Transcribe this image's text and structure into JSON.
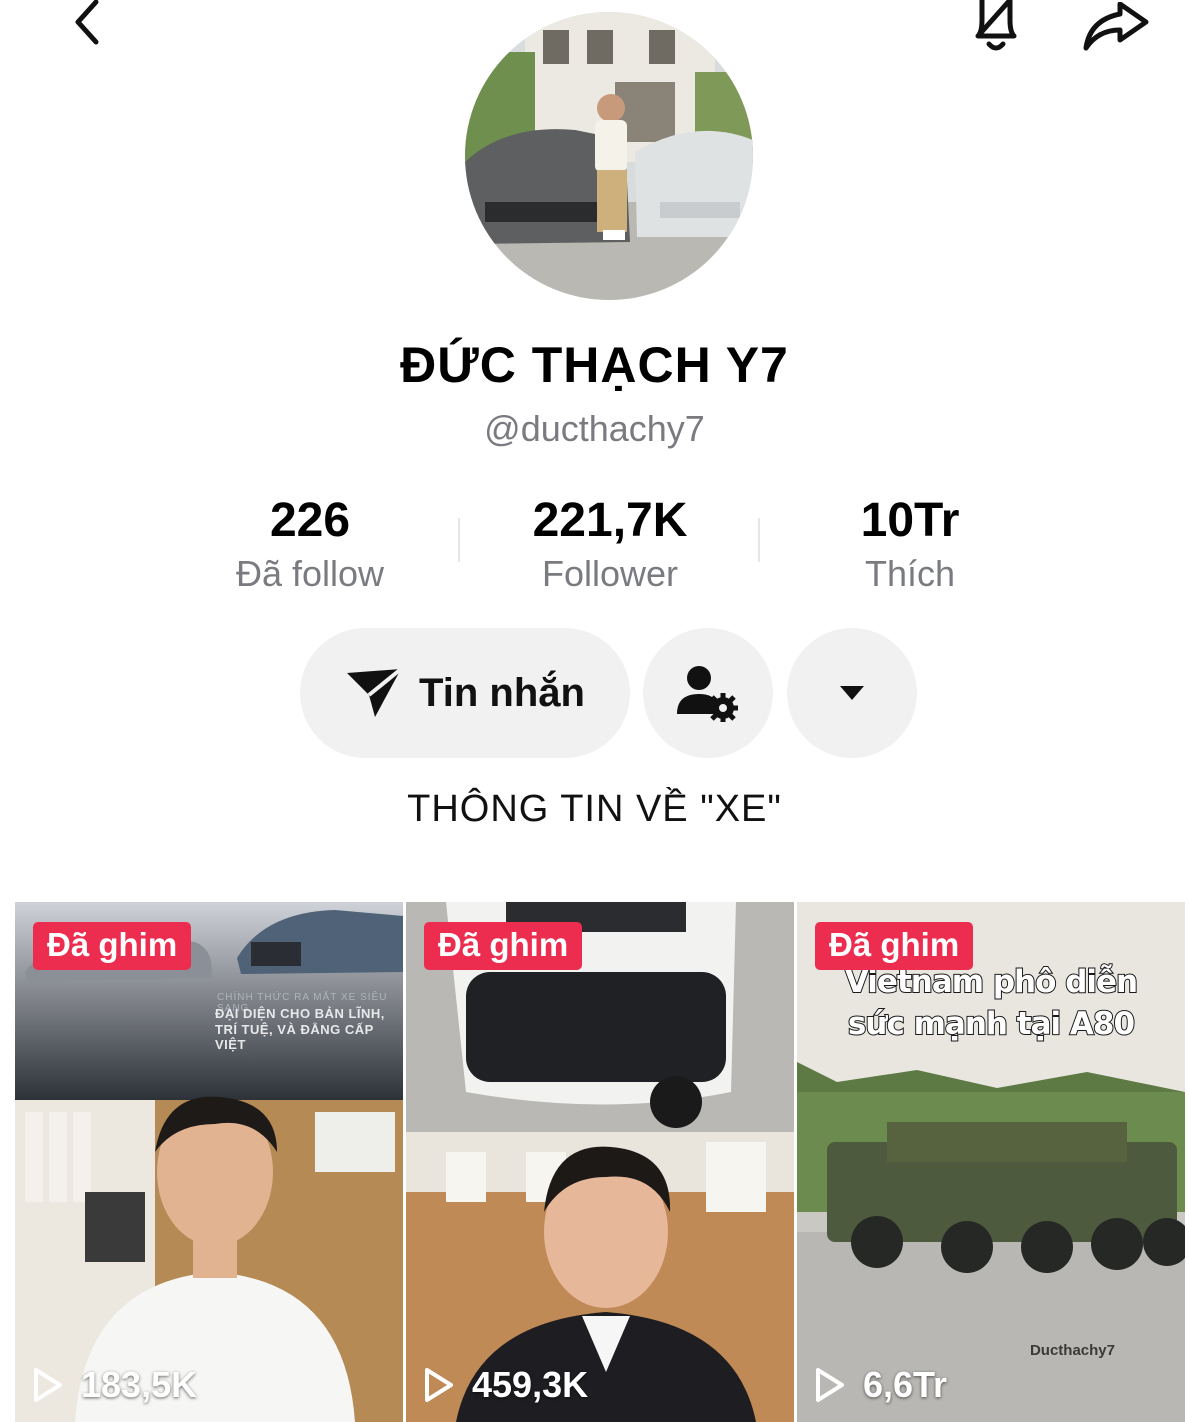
{
  "header": {
    "back_icon": "chevron-left-icon",
    "bell_icon": "bell-icon",
    "share_icon": "share-arrow-icon"
  },
  "profile": {
    "display_name": "ĐỨC THẠCH Y7",
    "handle": "@ducthachy7",
    "bio": "THÔNG TIN VỀ \"XE\""
  },
  "stats": [
    {
      "value": "226",
      "label": "Đã follow"
    },
    {
      "value": "221,7K",
      "label": "Follower"
    },
    {
      "value": "10Tr",
      "label": "Thích"
    }
  ],
  "actions": {
    "message_label": "Tin nhắn",
    "message_icon": "send-icon",
    "friend_icon": "user-settings-icon",
    "more_icon": "caret-down-icon"
  },
  "videos": [
    {
      "pinned_label": "Đã ghim",
      "views": "183,5K",
      "promo_line": "CHÍNH THỨC RA MẮT XE SIÊU SANG",
      "promo_text_1": "ĐẠI DIỆN CHO BẢN LĨNH,",
      "promo_text_2": "TRÍ TUỆ, VÀ ĐẲNG CẤP VIỆT"
    },
    {
      "pinned_label": "Đã ghim",
      "views": "459,3K"
    },
    {
      "pinned_label": "Đã ghim",
      "views": "6,6Tr",
      "caption_line_1": "Vietnam phô diễn",
      "caption_line_2": "sức mạnh tại A80",
      "watermark": "Ducthachy7"
    }
  ],
  "colors": {
    "accent_pin": "#ec2d4f",
    "pill_bg": "#f1f1f2",
    "muted_text": "#7a7b80"
  }
}
